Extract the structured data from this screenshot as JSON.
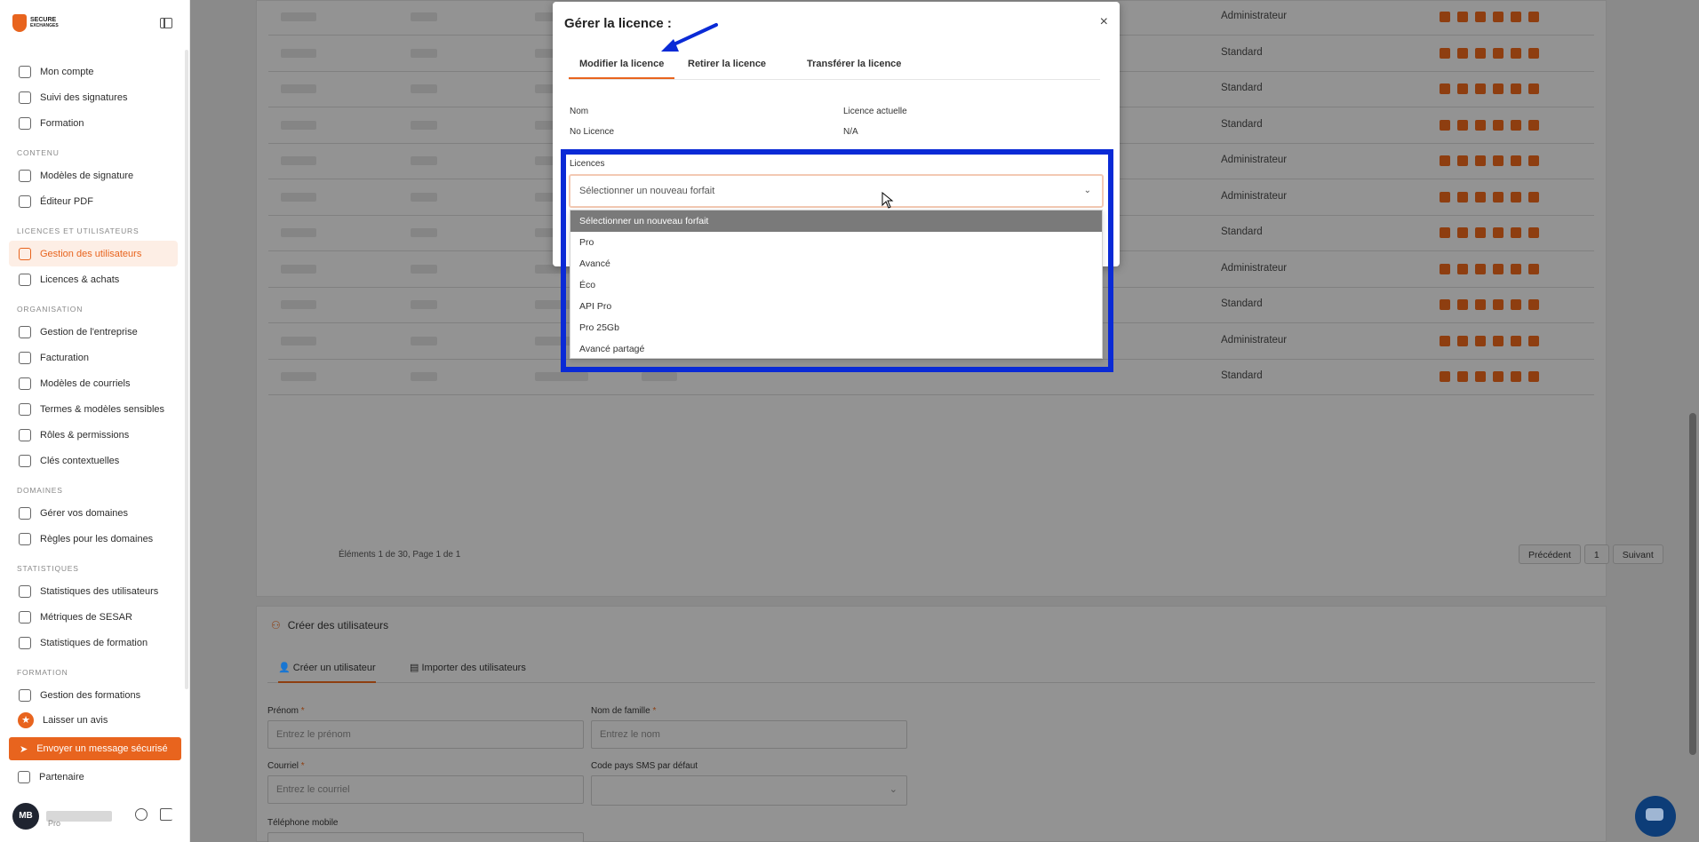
{
  "sidebar": {
    "logo_text_1": "SECURE",
    "logo_text_2": "EXCHANGES",
    "items_top": [
      {
        "label": "Mon compte",
        "icon": "user-icon"
      },
      {
        "label": "Suivi des signatures",
        "icon": "pen-icon"
      },
      {
        "label": "Formation",
        "icon": "book-icon"
      }
    ],
    "sections": [
      {
        "title": "CONTENU",
        "items": [
          {
            "label": "Modèles de signature",
            "icon": "template-icon"
          },
          {
            "label": "Éditeur PDF",
            "icon": "pdf-icon"
          }
        ]
      },
      {
        "title": "LICENCES ET UTILISATEURS",
        "items": [
          {
            "label": "Gestion des utilisateurs",
            "icon": "users-icon",
            "active": true
          },
          {
            "label": "Licences & achats",
            "icon": "license-icon"
          }
        ]
      },
      {
        "title": "ORGANISATION",
        "items": [
          {
            "label": "Gestion de l'entreprise",
            "icon": "building-icon"
          },
          {
            "label": "Facturation",
            "icon": "invoice-icon"
          },
          {
            "label": "Modèles de courriels",
            "icon": "mail-icon"
          },
          {
            "label": "Termes & modèles sensibles",
            "icon": "shield-icon"
          },
          {
            "label": "Rôles & permissions",
            "icon": "shield-check-icon"
          },
          {
            "label": "Clés contextuelles",
            "icon": "key-icon"
          }
        ]
      },
      {
        "title": "DOMAINES",
        "items": [
          {
            "label": "Gérer vos domaines",
            "icon": "globe-icon"
          },
          {
            "label": "Règles pour les domaines",
            "icon": "rules-icon"
          }
        ]
      },
      {
        "title": "STATISTIQUES",
        "items": [
          {
            "label": "Statistiques des utilisateurs",
            "icon": "bar-chart-icon"
          },
          {
            "label": "Métriques de SESAR",
            "icon": "line-chart-icon"
          },
          {
            "label": "Statistiques de formation",
            "icon": "stats-icon"
          }
        ]
      },
      {
        "title": "FORMATION",
        "items": [
          {
            "label": "Gestion des formations",
            "icon": "training-icon"
          }
        ]
      }
    ],
    "review_label": "Laisser un avis",
    "send_label": "Envoyer un message sécurisé",
    "partner_label": "Partenaire",
    "user_initials": "MB",
    "user_plan": "Pro"
  },
  "table": {
    "roles": [
      "Administrateur",
      "Standard",
      "Standard",
      "Standard",
      "Administrateur",
      "Administrateur",
      "Standard",
      "Administrateur",
      "Standard",
      "Administrateur",
      "Standard"
    ],
    "pagination_text": "Éléments 1 de 30, Page 1 de 1",
    "prev_label": "Précédent",
    "page_number": "1",
    "next_label": "Suivant"
  },
  "create": {
    "title": "Créer des utilisateurs",
    "tab_create": "Créer un utilisateur",
    "tab_import": "Importer des utilisateurs",
    "firstname_label": "Prénom",
    "firstname_placeholder": "Entrez le prénom",
    "lastname_label": "Nom de famille",
    "lastname_placeholder": "Entrez le nom",
    "email_label": "Courriel",
    "email_placeholder": "Entrez le courriel",
    "sms_label": "Code pays SMS par défaut",
    "phone_label": "Téléphone mobile",
    "required_mark": "*"
  },
  "modal": {
    "title": "Gérer la licence :",
    "close": "×",
    "tabs": [
      "Modifier la licence",
      "Retirer la licence",
      "Transférer la licence"
    ],
    "name_header": "Nom",
    "current_header": "Licence actuelle",
    "name_value": "No Licence",
    "current_value": "N/A",
    "licences_label": "Licences",
    "select_placeholder": "Sélectionner un nouveau forfait",
    "options": [
      "Sélectionner un nouveau forfait",
      "Pro",
      "Avancé",
      "Éco",
      "API Pro",
      "Pro 25Gb",
      "Avancé partagé"
    ]
  },
  "colors": {
    "accent": "#e8641e",
    "annotation_blue": "#0a2ad6"
  }
}
